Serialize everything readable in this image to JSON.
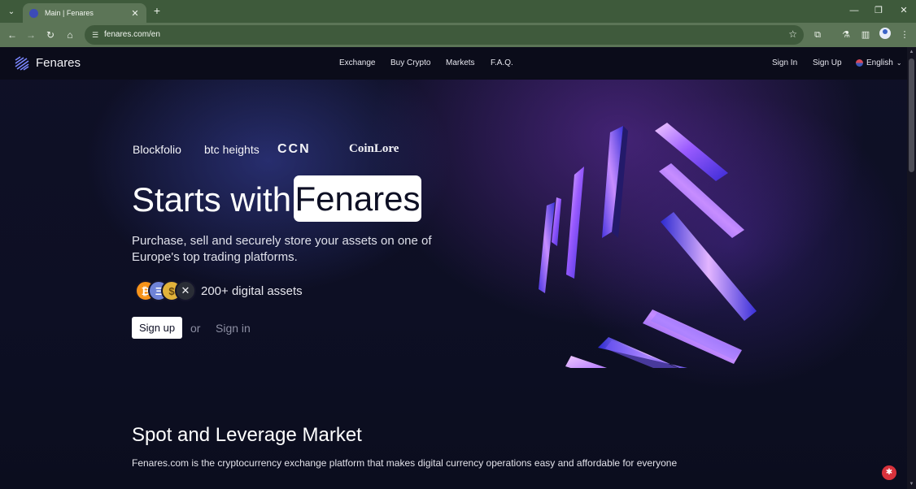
{
  "browser": {
    "tab_title": "Main | Fenares",
    "url": "fenares.com/en"
  },
  "header": {
    "brand": "Fenares",
    "nav": [
      "Exchange",
      "Buy Crypto",
      "Markets",
      "F.A.Q."
    ],
    "sign_in": "Sign In",
    "sign_up": "Sign Up",
    "language": "English"
  },
  "hero": {
    "partners": [
      "Blockfolio",
      "btc heights",
      "CCN",
      "CoinLore"
    ],
    "title": "Starts with",
    "highlight": "Fenares",
    "subtitle": "Purchase, sell and securely store your assets on one of Europe's top trading platforms.",
    "coins": [
      {
        "icon": "bitcoin-icon",
        "color": "#f7931a",
        "glyph": "₿"
      },
      {
        "icon": "ethereum-icon",
        "color": "#6f83d8",
        "glyph": "Ξ"
      },
      {
        "icon": "gold-coin-icon",
        "color": "#e2b23a",
        "glyph": "$"
      },
      {
        "icon": "xrp-icon",
        "color": "#2a2d36",
        "glyph": "✕"
      }
    ],
    "assets_text": "200+ digital assets",
    "signup_label": "Sign up",
    "or_text": "or",
    "signin_label": "Sign in"
  },
  "section": {
    "title": "Spot and Leverage Market",
    "text": "Fenares.com is the cryptocurrency exchange platform that makes digital currency operations easy and affordable for everyone"
  },
  "colors": {
    "chrome": "#3e5a3b",
    "toolbar": "#5c7557",
    "page_bg": "#0d1020",
    "accent_purple": "#8f58ff",
    "help_red": "#d8323c"
  }
}
